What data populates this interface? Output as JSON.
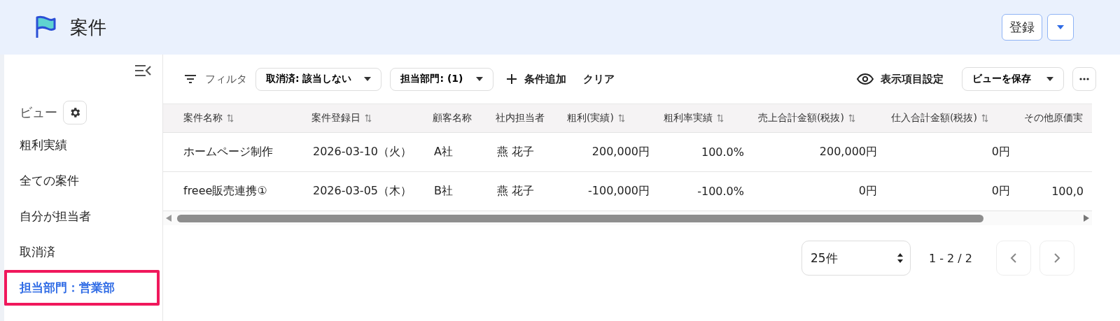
{
  "header": {
    "title": "案件",
    "buttons": [
      {
        "kind": "text",
        "label": "登録"
      },
      {
        "kind": "caret"
      }
    ]
  },
  "sidebar": {
    "section": "ビュー",
    "items": [
      {
        "label": "粗利実績",
        "selected": false,
        "highlighted": false
      },
      {
        "label": "全ての案件",
        "selected": false,
        "highlighted": false
      },
      {
        "label": "自分が担当者",
        "selected": false,
        "highlighted": false
      },
      {
        "label": "取消済",
        "selected": false,
        "highlighted": false
      },
      {
        "label": "担当部門：営業部",
        "selected": true,
        "highlighted": true
      }
    ]
  },
  "toolbar": {
    "filter_label": "フィルタ",
    "chips": [
      "取消済: 該当しない",
      "担当部門: (1)"
    ],
    "add_condition": "条件追加",
    "clear": "クリア",
    "columns_setting": "表示項目設定",
    "save_view": "ビューを保存"
  },
  "table": {
    "columns": [
      {
        "label": "案件名称",
        "sortable": true,
        "kind": "text"
      },
      {
        "label": "案件登録日",
        "sortable": true,
        "kind": "text"
      },
      {
        "label": "顧客名称",
        "sortable": false,
        "kind": "text"
      },
      {
        "label": "社内担当者",
        "sortable": false,
        "kind": "text"
      },
      {
        "label": "粗利(実績)",
        "sortable": true,
        "kind": "number"
      },
      {
        "label": "粗利率実績",
        "sortable": true,
        "kind": "number"
      },
      {
        "label": "売上合計金額(税抜)",
        "sortable": true,
        "kind": "number"
      },
      {
        "label": "仕入合計金額(税抜)",
        "sortable": true,
        "kind": "number"
      },
      {
        "label": "その他原価実",
        "kind": "number"
      }
    ],
    "rows": [
      [
        "ホームページ制作",
        "2026-03-10（火）",
        "A社",
        "燕 花子",
        "200,000円",
        "100.0%",
        "200,000円",
        "0円",
        ""
      ],
      [
        "freee販売連携①",
        "2026-03-05（木）",
        "B社",
        "燕 花子",
        "-100,000円",
        "-100.0%",
        "0円",
        "0円",
        "100,0"
      ]
    ]
  },
  "pagination": {
    "page_size": "25件",
    "range": "1 - 2 / 2"
  }
}
